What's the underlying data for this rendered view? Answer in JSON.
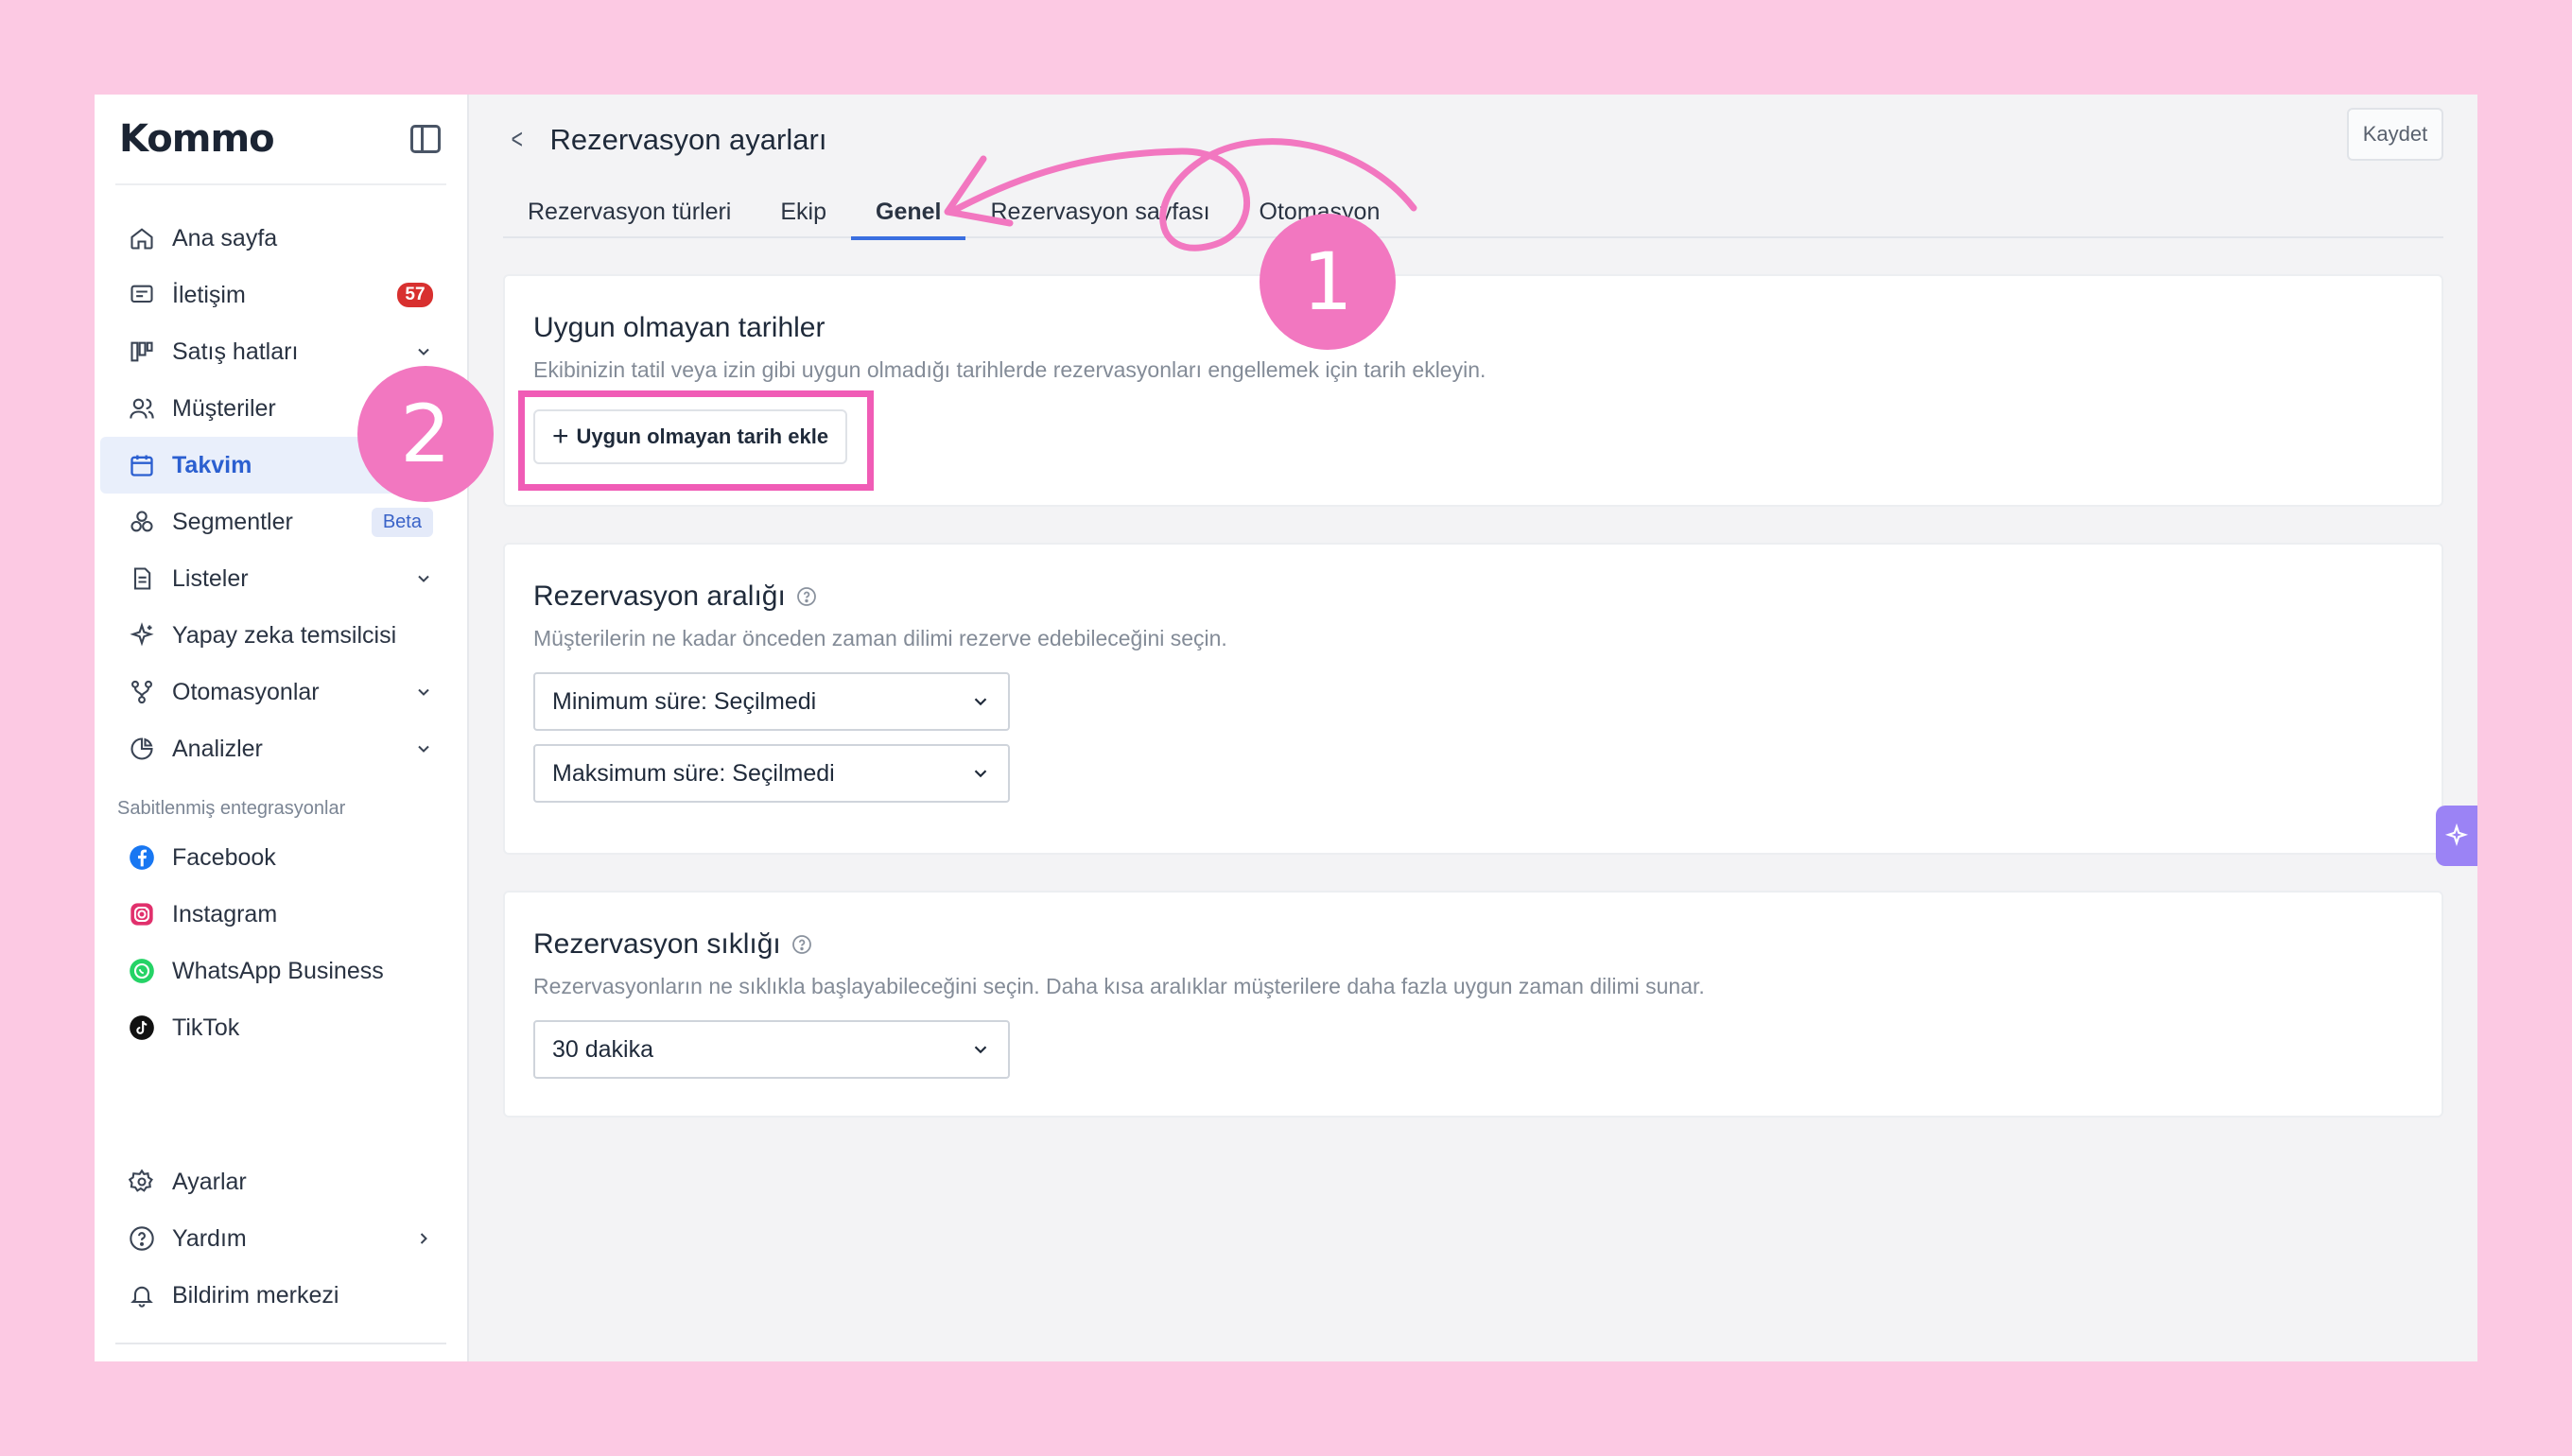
{
  "brand": {
    "logo": "Kommo"
  },
  "sidebar": {
    "items": [
      {
        "label": "Ana sayfa",
        "icon": "home-icon"
      },
      {
        "label": "İletişim",
        "icon": "chat-icon",
        "badge": "57"
      },
      {
        "label": "Satış hatları",
        "icon": "pipeline-icon"
      },
      {
        "label": "Müşteriler",
        "icon": "users-icon"
      },
      {
        "label": "Takvim",
        "icon": "calendar-icon",
        "active": true
      },
      {
        "label": "Segmentler",
        "icon": "segments-icon",
        "badge": "Beta"
      },
      {
        "label": "Listeler",
        "icon": "list-icon"
      },
      {
        "label": "Yapay zeka temsilcisi",
        "icon": "sparkle-icon"
      },
      {
        "label": "Otomasyonlar",
        "icon": "automation-icon"
      },
      {
        "label": "Analizler",
        "icon": "analytics-icon"
      }
    ],
    "pinned_label": "Sabitlenmiş entegrasyonlar",
    "integrations": [
      {
        "label": "Facebook",
        "icon": "facebook-icon"
      },
      {
        "label": "Instagram",
        "icon": "instagram-icon"
      },
      {
        "label": "WhatsApp Business",
        "icon": "whatsapp-icon"
      },
      {
        "label": "TikTok",
        "icon": "tiktok-icon"
      }
    ],
    "bottom": [
      {
        "label": "Ayarlar",
        "icon": "gear-icon"
      },
      {
        "label": "Yardım",
        "icon": "help-icon"
      },
      {
        "label": "Bildirim merkezi",
        "icon": "bell-icon"
      }
    ]
  },
  "header": {
    "back": "<",
    "title": "Rezervasyon ayarları",
    "save_label": "Kaydet"
  },
  "tabs": [
    {
      "label": "Rezervasyon türleri"
    },
    {
      "label": "Ekip"
    },
    {
      "label": "Genel",
      "active": true
    },
    {
      "label": "Rezervasyon sayfası"
    },
    {
      "label": "Otomasyon"
    }
  ],
  "unavailable": {
    "title": "Uygun olmayan tarihler",
    "description": "Ekibinizin tatil veya izin gibi uygun olmadığı tarihlerde rezervasyonları engellemek için tarih ekleyin.",
    "add_button": "Uygun olmayan tarih ekle",
    "add_plus": "+"
  },
  "range": {
    "title": "Rezervasyon aralığı",
    "description": "Müşterilerin ne kadar önceden zaman dilimi rezerve edebileceğini seçin.",
    "min_select": "Minimum süre: Seçilmedi",
    "max_select": "Maksimum süre: Seçilmedi"
  },
  "frequency": {
    "title": "Rezervasyon sıklığı",
    "description": "Rezervasyonların ne sıklıkla başlayabileceğini seçin. Daha kısa aralıklar müşterilere daha fazla uygun zaman dilimi sunar.",
    "select": "30 dakika"
  },
  "annotations": {
    "step1": "1",
    "step2": "2",
    "color": "#f277c0"
  },
  "colors": {
    "background": "#fcc9e3",
    "accent": "#3a6fe0",
    "active_nav": "#2b5fd0",
    "badge_red": "#d8302f",
    "highlight": "#f05cb6"
  }
}
